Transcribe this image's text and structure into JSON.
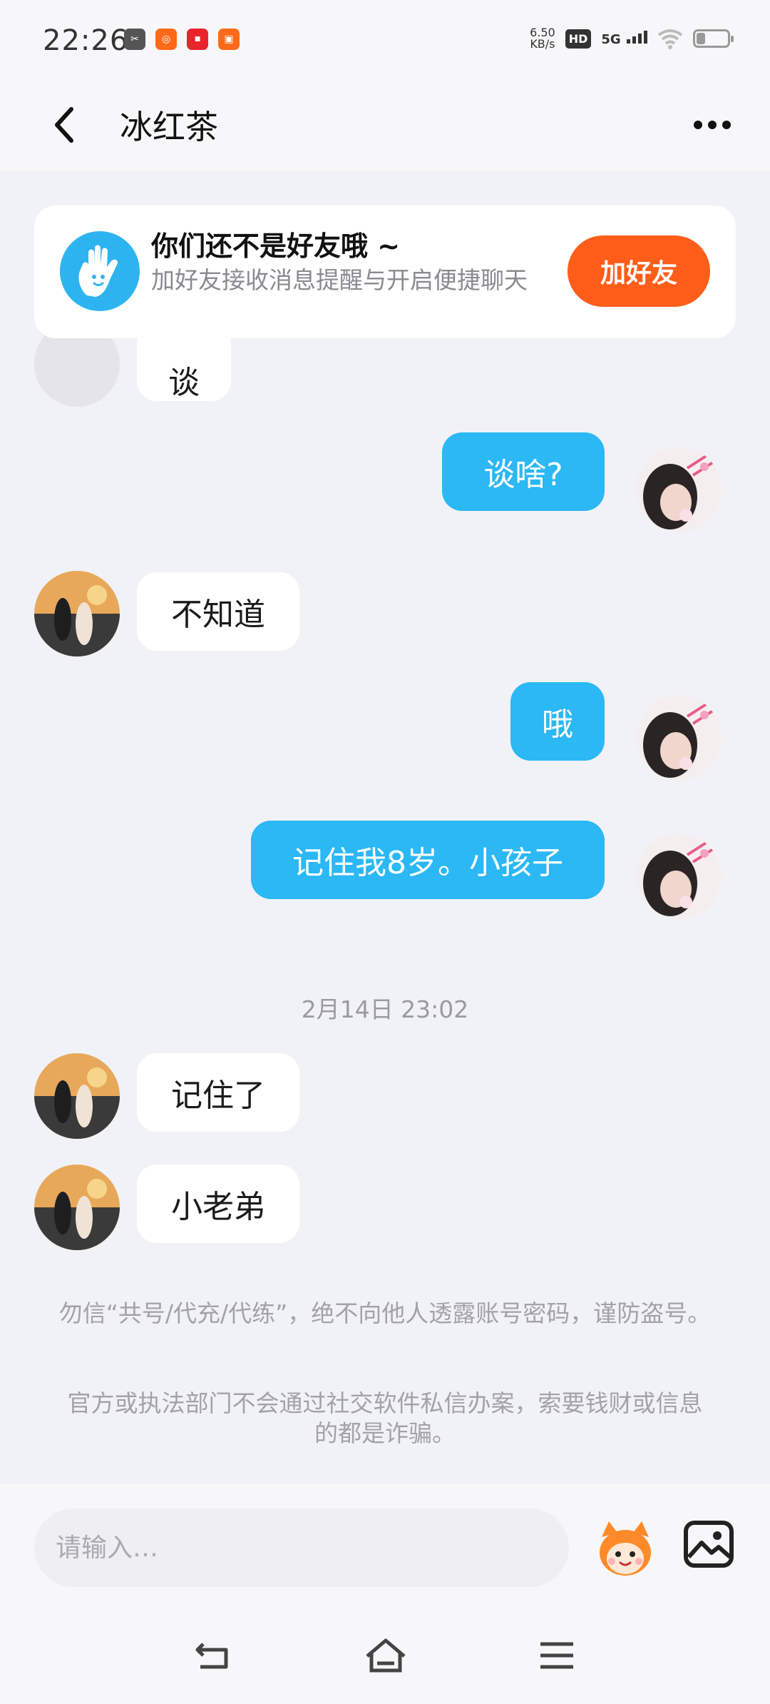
{
  "status_bar": {
    "time": "22:26",
    "net_speed_value": "6.50",
    "net_speed_unit": "KB/s",
    "hd": "HD",
    "network": "5G",
    "battery_level": 0.3
  },
  "header": {
    "title": "冰红茶"
  },
  "banner": {
    "title": "你们还不是好友哦 ~",
    "subtitle": "加好友接收消息提醒与开启便捷聊天",
    "button_label": "加好友"
  },
  "messages": [
    {
      "side": "in",
      "text": "谈"
    },
    {
      "side": "out",
      "text": "谈啥?"
    },
    {
      "side": "in",
      "text": "不知道"
    },
    {
      "side": "out",
      "text": "哦"
    },
    {
      "side": "out",
      "text": "记住我8岁。小孩子"
    },
    {
      "side": "in",
      "text": "记住了"
    },
    {
      "side": "in",
      "text": "小老弟"
    }
  ],
  "timestamp": "2月14日 23:02",
  "notices": [
    "勿信“共号/代充/代练”，绝不向他人透露账号密码，谨防盗号。",
    "官方或执法部门不会通过社交软件私信办案，索要钱财或信息的都是诈骗。"
  ],
  "input": {
    "placeholder": "请输入…"
  },
  "colors": {
    "outgoing_bubble": "#2bb8f5",
    "add_friend_button": "#ff5d1a",
    "banner_icon": "#2db4f0"
  }
}
